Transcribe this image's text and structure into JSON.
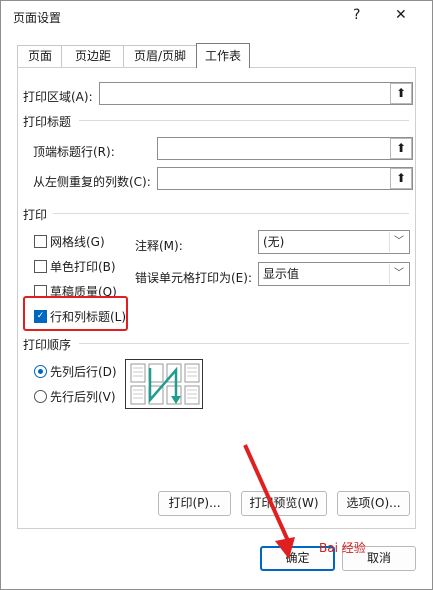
{
  "window": {
    "title": "页面设置",
    "help_icon": "?",
    "close_icon": "✕"
  },
  "tabs": [
    {
      "label": "页面"
    },
    {
      "label": "页边距"
    },
    {
      "label": "页眉/页脚"
    },
    {
      "label": "工作表",
      "active": true
    }
  ],
  "print_area": {
    "label": "打印区域(A):",
    "value": ""
  },
  "print_titles": {
    "title": "打印标题",
    "rows_label": "顶端标题行(R):",
    "rows_value": "",
    "cols_label": "从左侧重复的列数(C):",
    "cols_value": ""
  },
  "print": {
    "title": "打印",
    "gridlines_label": "网格线(G)",
    "gridlines_checked": false,
    "bw_label": "单色打印(B)",
    "bw_checked": false,
    "draft_label": "草稿质量(Q)",
    "draft_checked": false,
    "headings_label": "行和列标题(L)",
    "headings_checked": true,
    "comments_label": "注释(M):",
    "comments_value": "(无)",
    "errors_label": "错误单元格打印为(E):",
    "errors_value": "显示值"
  },
  "page_order": {
    "title": "打印顺序",
    "down_then_over_label": "先列后行(D)",
    "over_then_down_label": "先行后列(V)",
    "selected": "down_then_over"
  },
  "buttons": {
    "print": "打印(P)...",
    "print_preview": "打印预览(W)",
    "options": "选项(O)...",
    "ok": "确定",
    "cancel": "取消"
  },
  "watermark_text": "Bai 经验",
  "colors": {
    "accent": "#0067c0",
    "highlight": "#e02020",
    "preview_arrow": "#1f9d8f"
  }
}
